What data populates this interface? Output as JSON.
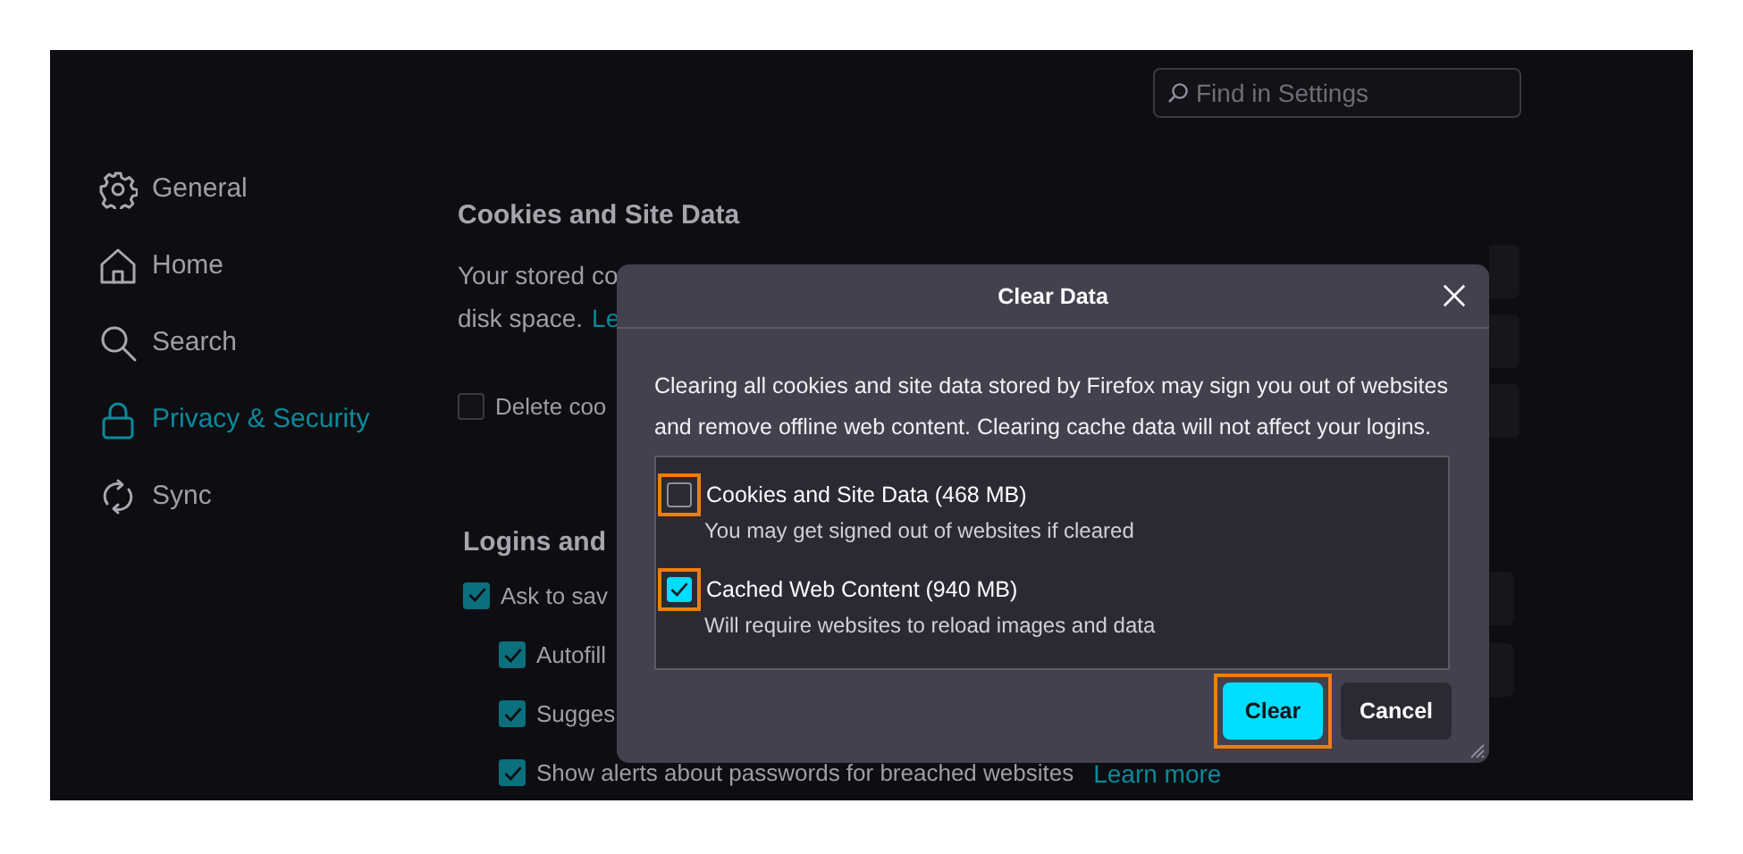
{
  "search": {
    "placeholder": "Find in Settings"
  },
  "sidebar": {
    "items": [
      {
        "label": "General",
        "kind": "gear",
        "selected": false
      },
      {
        "label": "Home",
        "kind": "home",
        "selected": false
      },
      {
        "label": "Search",
        "kind": "search",
        "selected": false
      },
      {
        "label": "Privacy & Security",
        "kind": "lock",
        "selected": true
      },
      {
        "label": "Sync",
        "kind": "sync",
        "selected": false
      }
    ]
  },
  "cookies_section": {
    "heading": "Cookies and Site Data",
    "text_line_1": "Your stored co",
    "text_line_2": "disk space.",
    "link": "Le",
    "checkbox": {
      "label": "Delete coo",
      "checked": false
    }
  },
  "logins_section": {
    "heading": "Logins and",
    "options": [
      {
        "label": "Ask to sav",
        "checked": true,
        "children": [
          {
            "label": "Autofill",
            "checked": true
          },
          {
            "label": "Sugges",
            "checked": true
          },
          {
            "label": "Show alerts about passwords for breached websites",
            "checked": true,
            "link": "Learn more"
          }
        ]
      }
    ]
  },
  "dialog": {
    "title": "Clear Data",
    "description": "Clearing all cookies and site data stored by Firefox may sign you out of websites and remove offline web content. Clearing cache data will not affect your logins.",
    "options": [
      {
        "label": "Cookies and Site Data (468 MB)",
        "hint": "You may get signed out of websites if cleared",
        "checked": false,
        "highlighted": true
      },
      {
        "label": "Cached Web Content (940 MB)",
        "hint": "Will require websites to reload images and data",
        "checked": true,
        "highlighted": true
      }
    ],
    "buttons": [
      {
        "label": "Clear",
        "kind": "primary",
        "highlighted": true
      },
      {
        "label": "Cancel",
        "kind": "secondary",
        "highlighted": false
      }
    ]
  }
}
